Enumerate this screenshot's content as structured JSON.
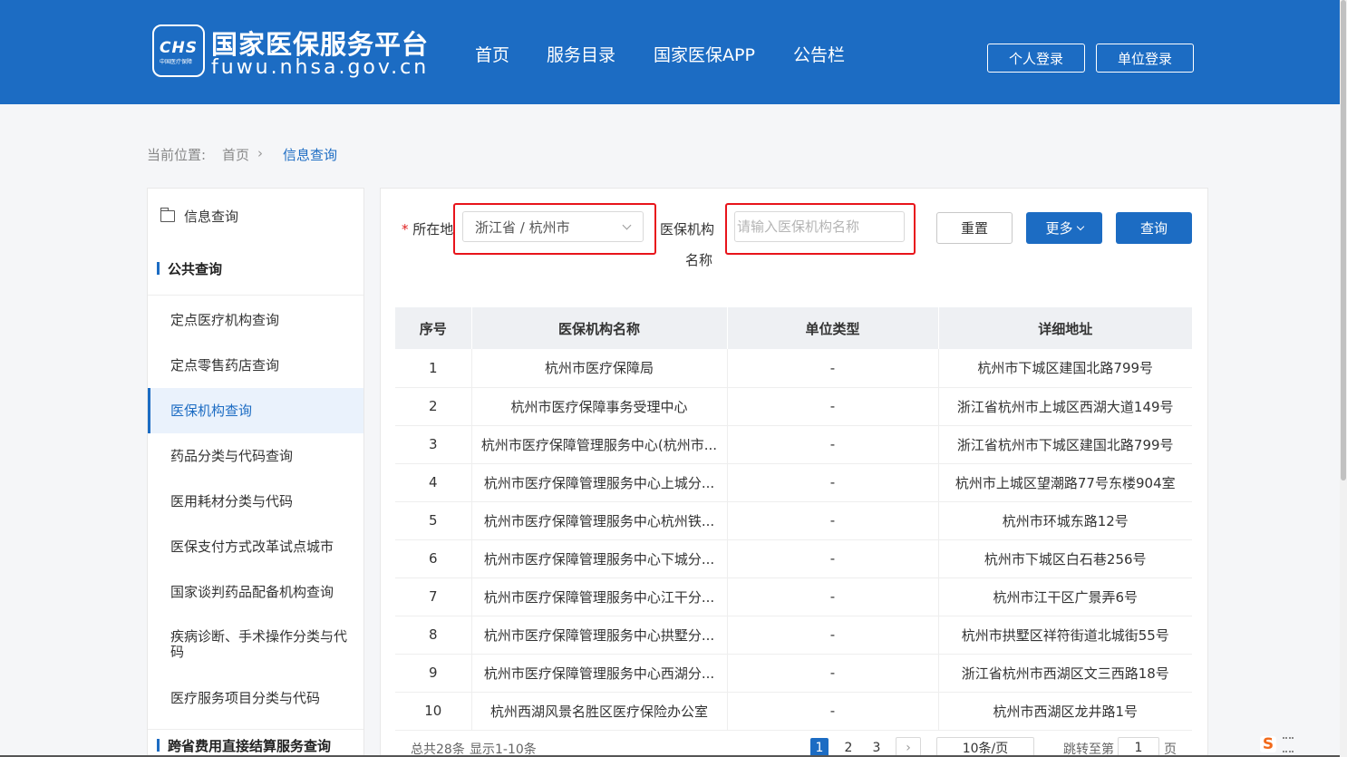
{
  "header": {
    "logo_mark": "CHS",
    "logo_sub": "中国医疗保障",
    "site_title": "国家医保服务平台",
    "site_url": "fuwu.nhsa.gov.cn",
    "nav": [
      "首页",
      "服务目录",
      "国家医保APP",
      "公告栏"
    ],
    "personal_login": "个人登录",
    "unit_login": "单位登录"
  },
  "breadcrumb": {
    "prefix": "当前位置:",
    "home": "首页",
    "current": "信息查询"
  },
  "sidebar": {
    "title": "信息查询",
    "section1": "公共查询",
    "items": [
      "定点医疗机构查询",
      "定点零售药店查询",
      "医保机构查询",
      "药品分类与代码查询",
      "医用耗材分类与代码",
      "医保支付方式改革试点城市",
      "国家谈判药品配备机构查询",
      "疾病诊断、手术操作分类与代码",
      "医疗服务项目分类与代码"
    ],
    "active_index": 2,
    "section2": "跨省费用直接结算服务查询"
  },
  "filters": {
    "required_mark": "*",
    "location_label": "所在地",
    "location_value": "浙江省 / 杭州市",
    "org_label_line1": "医保机构",
    "org_label_line2": "名称",
    "org_placeholder": "请输入医保机构名称",
    "reset": "重置",
    "more": "更多",
    "query": "查询"
  },
  "table": {
    "headers": [
      "序号",
      "医保机构名称",
      "单位类型",
      "详细地址"
    ],
    "rows": [
      [
        "1",
        "杭州市医疗保障局",
        "-",
        "杭州市下城区建国北路799号"
      ],
      [
        "2",
        "杭州市医疗保障事务受理中心",
        "-",
        "浙江省杭州市上城区西湖大道149号"
      ],
      [
        "3",
        "杭州市医疗保障管理服务中心(杭州市...",
        "-",
        "浙江省杭州市下城区建国北路799号"
      ],
      [
        "4",
        "杭州市医疗保障管理服务中心上城分...",
        "-",
        "杭州市上城区望潮路77号东楼904室"
      ],
      [
        "5",
        "杭州市医疗保障管理服务中心杭州铁...",
        "-",
        "杭州市环城东路12号"
      ],
      [
        "6",
        "杭州市医疗保障管理服务中心下城分...",
        "-",
        "杭州市下城区白石巷256号"
      ],
      [
        "7",
        "杭州市医疗保障管理服务中心江干分...",
        "-",
        "杭州市江干区广景弄6号"
      ],
      [
        "8",
        "杭州市医疗保障管理服务中心拱墅分...",
        "-",
        "杭州市拱墅区祥符街道北城街55号"
      ],
      [
        "9",
        "杭州市医疗保障管理服务中心西湖分...",
        "-",
        "浙江省杭州市西湖区文三西路18号"
      ],
      [
        "10",
        "杭州西湖风景名胜区医疗保险办公室",
        "-",
        "杭州市西湖区龙井路1号"
      ]
    ]
  },
  "pagination": {
    "total": "总共28条",
    "showing": "显示1-10条",
    "pages": [
      "1",
      "2",
      "3"
    ],
    "current_page": "1",
    "page_size": "10条/页",
    "jump_prefix": "跳转至第",
    "jump_value": "1",
    "jump_suffix": "页"
  },
  "colors": {
    "brand": "#1c6cc3",
    "highlight": "#e8141b"
  }
}
